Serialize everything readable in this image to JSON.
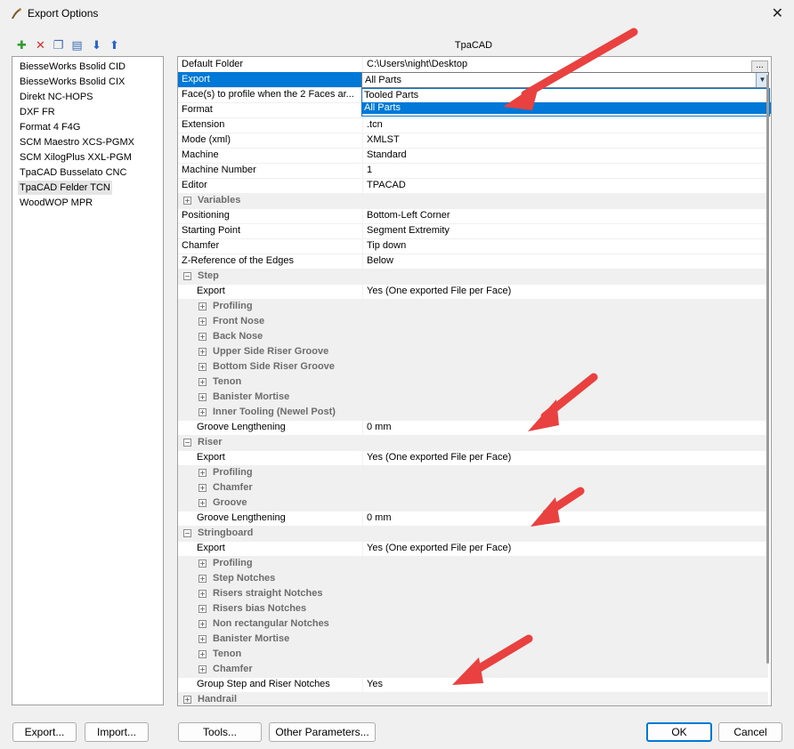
{
  "window": {
    "title": "Export Options",
    "close_glyph": "✕"
  },
  "toolbar": [
    {
      "icon": "add-icon",
      "glyph": "✚",
      "color": "#2e9b2e"
    },
    {
      "icon": "delete-icon",
      "glyph": "✕",
      "color": "#d42b2b"
    },
    {
      "icon": "copy-icon",
      "glyph": "❐",
      "color": "#3a6db5"
    },
    {
      "icon": "properties-icon",
      "glyph": "▤",
      "color": "#3a6db5"
    },
    {
      "icon": "move-down-icon",
      "glyph": "⬇",
      "color": "#2a63c9"
    },
    {
      "icon": "move-up-icon",
      "glyph": "⬆",
      "color": "#2a63c9"
    }
  ],
  "providers": [
    "BiesseWorks Bsolid CID",
    "BiesseWorks Bsolid CIX",
    "Direkt NC-HOPS",
    "DXF FR",
    "Format 4 F4G",
    "SCM Maestro XCS-PGMX",
    "SCM XilogPlus XXL-PGM",
    "TpaCAD Busselato CNC",
    "TpaCAD Felder TCN",
    "WoodWOP MPR"
  ],
  "selected_provider_index": 8,
  "grid": {
    "title": "TpaCAD",
    "rows": [
      {
        "label": "Default Folder",
        "value": "C:\\Users\\night\\Desktop",
        "indent": 0,
        "type": "prop",
        "has_browse": true
      },
      {
        "label": "Export",
        "value": "All Parts",
        "indent": 0,
        "type": "prop",
        "selected": true,
        "dropdown": true
      },
      {
        "label": "Face(s) to profile when the 2 Faces ar...",
        "value": "",
        "indent": 0,
        "type": "prop"
      },
      {
        "label": "Format",
        "value": "",
        "indent": 0,
        "type": "prop"
      },
      {
        "label": "Extension",
        "value": ".tcn",
        "indent": 0,
        "type": "prop"
      },
      {
        "label": "Mode (xml)",
        "value": "XMLST",
        "indent": 0,
        "type": "prop"
      },
      {
        "label": "Machine",
        "value": "Standard",
        "indent": 0,
        "type": "prop"
      },
      {
        "label": "Machine Number",
        "value": "1",
        "indent": 0,
        "type": "prop"
      },
      {
        "label": "Editor",
        "value": "TPACAD",
        "indent": 0,
        "type": "prop"
      },
      {
        "label": "Variables",
        "value": "",
        "indent": 0,
        "type": "cat",
        "expander": "+"
      },
      {
        "label": "Positioning",
        "value": "Bottom-Left Corner",
        "indent": 0,
        "type": "prop"
      },
      {
        "label": "Starting Point",
        "value": "Segment Extremity",
        "indent": 0,
        "type": "prop"
      },
      {
        "label": "Chamfer",
        "value": "Tip down",
        "indent": 0,
        "type": "prop"
      },
      {
        "label": "Z-Reference of the Edges",
        "value": "Below",
        "indent": 0,
        "type": "prop"
      },
      {
        "label": "Step",
        "value": "",
        "indent": 0,
        "type": "cat",
        "expander": "−"
      },
      {
        "label": "Export",
        "value": "Yes (One exported File per Face)",
        "indent": 1,
        "type": "prop"
      },
      {
        "label": "Profiling",
        "value": "",
        "indent": 1,
        "type": "cat",
        "expander": "+"
      },
      {
        "label": "Front Nose",
        "value": "",
        "indent": 1,
        "type": "cat",
        "expander": "+"
      },
      {
        "label": "Back Nose",
        "value": "",
        "indent": 1,
        "type": "cat",
        "expander": "+"
      },
      {
        "label": "Upper Side Riser Groove",
        "value": "",
        "indent": 1,
        "type": "cat",
        "expander": "+"
      },
      {
        "label": "Bottom Side Riser Groove",
        "value": "",
        "indent": 1,
        "type": "cat",
        "expander": "+"
      },
      {
        "label": "Tenon",
        "value": "",
        "indent": 1,
        "type": "cat",
        "expander": "+"
      },
      {
        "label": "Banister Mortise",
        "value": "",
        "indent": 1,
        "type": "cat",
        "expander": "+"
      },
      {
        "label": "Inner Tooling (Newel Post)",
        "value": "",
        "indent": 1,
        "type": "cat",
        "expander": "+"
      },
      {
        "label": "Groove Lengthening",
        "value": "0 mm",
        "indent": 1,
        "type": "prop"
      },
      {
        "label": "Riser",
        "value": "",
        "indent": 0,
        "type": "cat",
        "expander": "−"
      },
      {
        "label": "Export",
        "value": "Yes (One exported File per Face)",
        "indent": 1,
        "type": "prop"
      },
      {
        "label": "Profiling",
        "value": "",
        "indent": 1,
        "type": "cat",
        "expander": "+"
      },
      {
        "label": "Chamfer",
        "value": "",
        "indent": 1,
        "type": "cat",
        "expander": "+"
      },
      {
        "label": "Groove",
        "value": "",
        "indent": 1,
        "type": "cat",
        "expander": "+"
      },
      {
        "label": "Groove Lengthening",
        "value": "0 mm",
        "indent": 1,
        "type": "prop"
      },
      {
        "label": "Stringboard",
        "value": "",
        "indent": 0,
        "type": "cat",
        "expander": "−"
      },
      {
        "label": "Export",
        "value": "Yes (One exported File per Face)",
        "indent": 1,
        "type": "prop"
      },
      {
        "label": "Profiling",
        "value": "",
        "indent": 1,
        "type": "cat",
        "expander": "+"
      },
      {
        "label": "Step Notches",
        "value": "",
        "indent": 1,
        "type": "cat",
        "expander": "+"
      },
      {
        "label": "Risers straight Notches",
        "value": "",
        "indent": 1,
        "type": "cat",
        "expander": "+"
      },
      {
        "label": "Risers bias Notches",
        "value": "",
        "indent": 1,
        "type": "cat",
        "expander": "+"
      },
      {
        "label": "Non rectangular Notches",
        "value": "",
        "indent": 1,
        "type": "cat",
        "expander": "+"
      },
      {
        "label": "Banister Mortise",
        "value": "",
        "indent": 1,
        "type": "cat",
        "expander": "+"
      },
      {
        "label": "Tenon",
        "value": "",
        "indent": 1,
        "type": "cat",
        "expander": "+"
      },
      {
        "label": "Chamfer",
        "value": "",
        "indent": 1,
        "type": "cat",
        "expander": "+"
      },
      {
        "label": "Group Step and Riser Notches",
        "value": "Yes",
        "indent": 1,
        "type": "prop"
      },
      {
        "label": "Handrail",
        "value": "",
        "indent": 0,
        "type": "cat",
        "expander": "+"
      }
    ]
  },
  "dropdown": {
    "options": [
      "Tooled Parts",
      "All Parts"
    ],
    "highlighted_index": 1,
    "arrow_glyph": "▼"
  },
  "browse_label": "...",
  "buttons": {
    "export": "Export...",
    "import": "Import...",
    "tools": "Tools...",
    "other": "Other Parameters...",
    "ok": "OK",
    "cancel": "Cancel"
  },
  "colors": {
    "accent": "#0078d7",
    "annotation_arrow": "#e8413f"
  }
}
